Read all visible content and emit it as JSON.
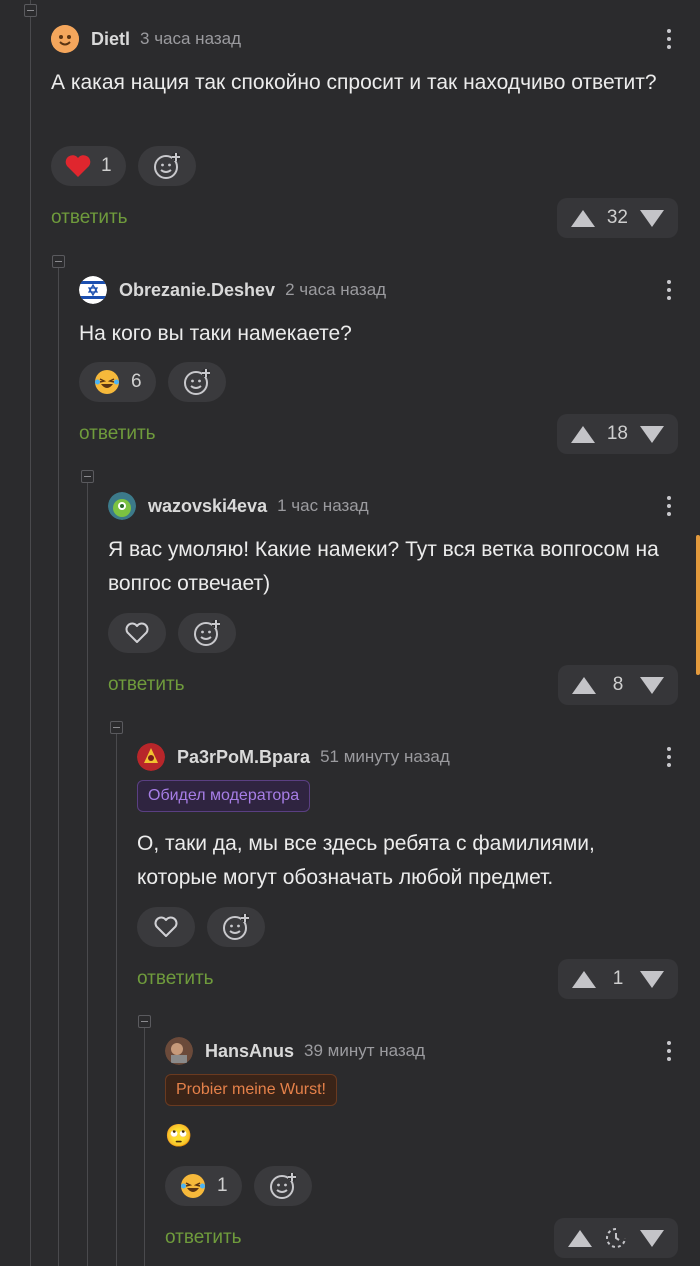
{
  "reply_label": "ответить",
  "comments": [
    {
      "username": "Dietl",
      "time": "3 часа назад",
      "text": "А какая нация так спокойно спросит и так находчиво ответит?",
      "reaction": {
        "icon": "heart-filled-icon",
        "count": "1"
      },
      "votes": "32"
    },
    {
      "username": "Obrezanie.Deshev",
      "time": "2 часа назад",
      "text": "На кого вы таки намекаете?",
      "reaction": {
        "icon": "laughing-emoji-icon",
        "count": "6"
      },
      "votes": "18"
    },
    {
      "username": "wazovski4eva",
      "time": "1 час назад",
      "text": "Я вас умоляю! Какие намеки? Тут вся ветка вопгосом на вопгос отвечает)",
      "reaction": {
        "icon": "heart-outline-icon"
      },
      "votes": "8"
    },
    {
      "username": "Pa3rPoM.Bpara",
      "time": "51 минуту назад",
      "badge": "Обидел модератора",
      "text": "О, таки да, мы все здесь ребята с фамилиями, которые могут обозначать любой предмет.",
      "reaction": {
        "icon": "heart-outline-icon"
      },
      "votes": "1"
    },
    {
      "username": "HansAnus",
      "time": "39 минут назад",
      "badge": "Probier meine Wurst!",
      "text": "🙄",
      "reaction": {
        "icon": "laughing-emoji-icon",
        "count": "1"
      },
      "votes_icon": "loading-icon"
    }
  ],
  "colors": {
    "background": "#2b2b2d",
    "reply": "#6f9b3c",
    "scroll_thumb": "#e39a3d"
  }
}
